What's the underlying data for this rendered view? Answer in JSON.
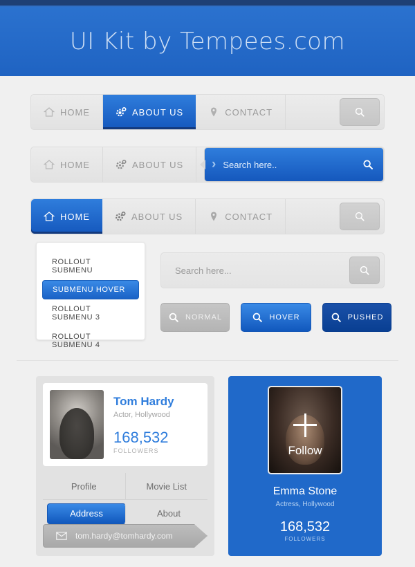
{
  "header": {
    "title": "UI Kit by Tempees.com",
    "brand_blue": "#2069c9",
    "topstrip_color": "#1e4075"
  },
  "nav1": {
    "items": [
      {
        "label": "HOME",
        "icon": "home-icon",
        "active": false
      },
      {
        "label": "ABOUT US",
        "icon": "gear-icon",
        "active": true
      },
      {
        "label": "CONTACT",
        "icon": "pin-icon",
        "active": false
      }
    ],
    "search_icon": "search-icon"
  },
  "nav2": {
    "items": [
      {
        "label": "HOME",
        "icon": "home-icon",
        "active": false
      },
      {
        "label": "ABOUT US",
        "icon": "gear-icon",
        "active": false
      }
    ],
    "search_placeholder": "Search here..",
    "chevron": "›",
    "search_icon": "search-icon"
  },
  "nav3": {
    "items": [
      {
        "label": "HOME",
        "icon": "home-icon",
        "active": true
      },
      {
        "label": "ABOUT US",
        "icon": "gear-icon",
        "active": false
      },
      {
        "label": "CONTACT",
        "icon": "pin-icon",
        "active": false
      }
    ],
    "search_icon": "search-icon"
  },
  "submenu": {
    "items": [
      {
        "label": "ROLLOUT SUBMENU",
        "active": false
      },
      {
        "label": "SUBMENU HOVER",
        "active": true
      },
      {
        "label": "ROLLOUT SUBMENU 3",
        "active": false
      },
      {
        "label": "ROLLOUT SUBMENU 4",
        "active": false
      }
    ]
  },
  "search_field": {
    "placeholder": "Search here...",
    "button_icon": "search-icon"
  },
  "buttons": [
    {
      "label": "NORMAL",
      "state": "normal",
      "icon": "search-icon",
      "color": "#bdbdbd"
    },
    {
      "label": "HOVER",
      "state": "hover",
      "icon": "search-icon",
      "color": "#2579db"
    },
    {
      "label": "PUSHED",
      "state": "pushed",
      "icon": "search-icon",
      "color": "#0d4699"
    }
  ],
  "profile_card": {
    "name": "Tom Hardy",
    "role": "Actor, Hollywood",
    "followers_count": "168,532",
    "followers_label": "FOLLOWERS",
    "tabs": [
      {
        "label": "Profile",
        "active": false
      },
      {
        "label": "Movie List",
        "active": false
      },
      {
        "label": "Address",
        "active": true
      },
      {
        "label": "About",
        "active": false
      }
    ],
    "email": "tom.hardy@tomhardy.com",
    "email_icon": "envelope-icon"
  },
  "follow_card": {
    "name": "Emma Stone",
    "role": "Actress, Hollywood",
    "followers_count": "168,532",
    "followers_label": "FOLLOWERS",
    "follow_label": "Follow",
    "plus_icon": "plus-icon",
    "background": "#2069c9"
  }
}
